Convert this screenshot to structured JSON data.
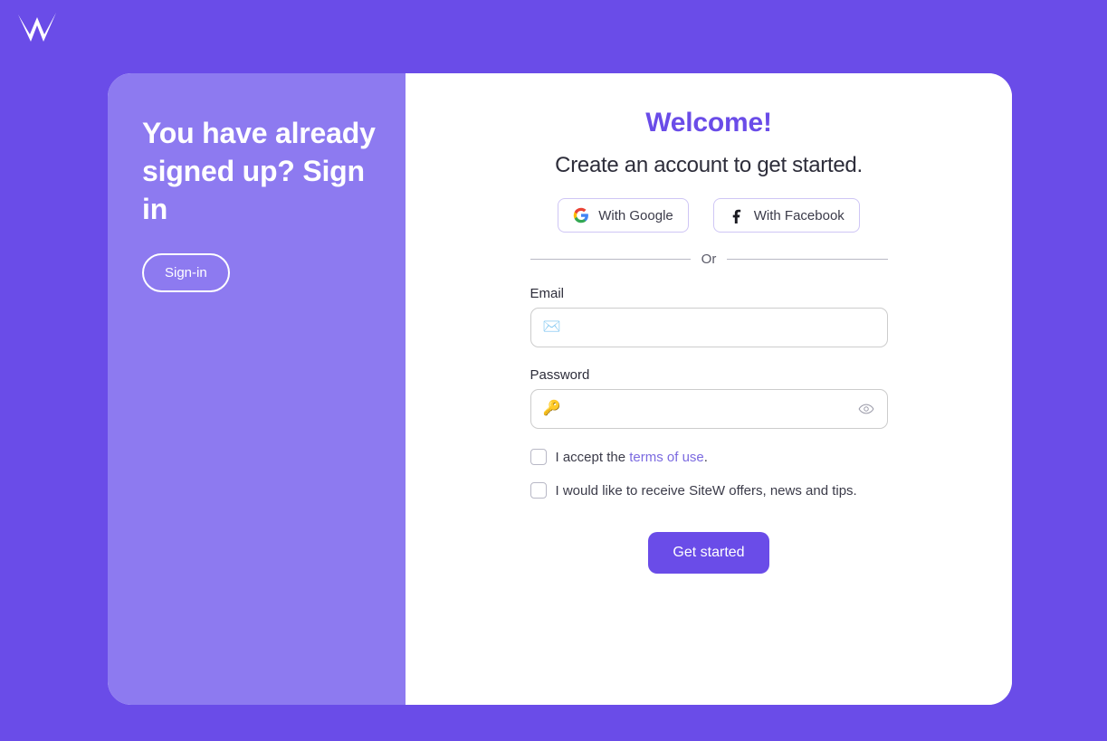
{
  "brand": {
    "logo_icon": "sitew-w-logo",
    "background_color": "#6a4ce8",
    "accent_color": "#6a4ce8",
    "panel_color": "#8d7af0",
    "link_color": "#7b6ae0"
  },
  "left_panel": {
    "heading": "You have already signed up? Sign in",
    "signin_label": "Sign-in"
  },
  "right_panel": {
    "title": "Welcome!",
    "subtitle": "Create an account to get started.",
    "social": [
      {
        "label": "With Google",
        "icon": "google-icon"
      },
      {
        "label": "With Facebook",
        "icon": "facebook-icon"
      }
    ],
    "divider_text": "Or",
    "fields": {
      "email": {
        "label": "Email",
        "value": "",
        "placeholder": "",
        "icon": "envelope-icon",
        "icon_glyph": "✉️"
      },
      "password": {
        "label": "Password",
        "value": "",
        "placeholder": "",
        "icon": "key-icon",
        "icon_glyph": "🔑",
        "toggle_icon": "eye-icon"
      }
    },
    "checkboxes": [
      {
        "checked": false,
        "text_before": "I accept the ",
        "link_text": "terms of use",
        "text_after": "."
      },
      {
        "checked": false,
        "text_before": "I would like to receive SiteW offers, news and tips.",
        "link_text": "",
        "text_after": ""
      }
    ],
    "submit_label": "Get started"
  }
}
